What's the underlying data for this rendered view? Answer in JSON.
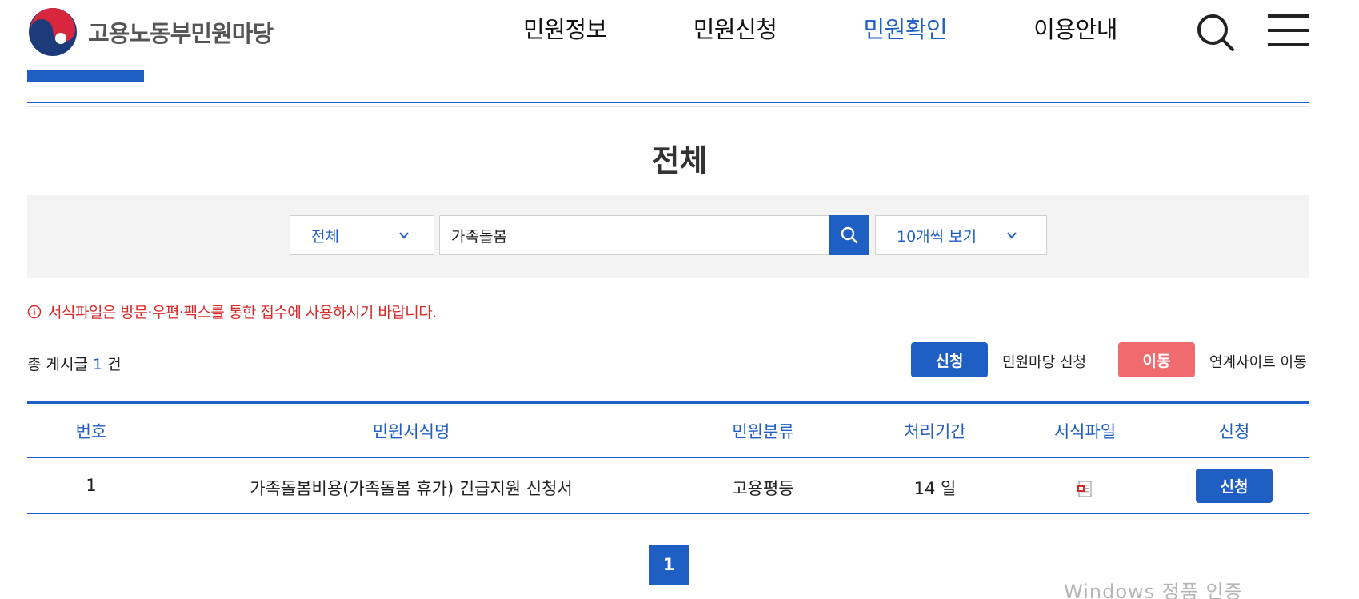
{
  "header": {
    "logo_text": "고용노동부민원마당",
    "nav": [
      "민원정보",
      "민원신청",
      "민원확인",
      "이용안내"
    ],
    "active_nav": "민원확인",
    "search_icon": "search-icon",
    "menu_icon": "hamburger-menu-icon"
  },
  "page": {
    "title": "전체"
  },
  "search": {
    "category": "전체",
    "keyword": "가족돌봄",
    "per_page": "10개씩 보기"
  },
  "notice": "서식파일은 방문·우편·팩스를 통한 접수에 사용하시기 바랍니다.",
  "summary": {
    "prefix": "총 게시글",
    "count": "1",
    "suffix": "건"
  },
  "legend": {
    "apply_button": "신청",
    "apply_text": "민원마당 신청",
    "move_button": "이동",
    "move_text": "연계사이트 이동"
  },
  "table": {
    "headers": [
      "번호",
      "민원서식명",
      "민원분류",
      "처리기간",
      "서식파일",
      "신청"
    ],
    "rows": [
      {
        "no": "1",
        "name": "가족돌봄비용(가족돌봄 휴가) 긴급지원 신청서",
        "category": "고용평등",
        "period": "14 일",
        "file_icon": "pdf-file-icon",
        "action": "신청"
      }
    ]
  },
  "pagination": {
    "current": "1"
  },
  "watermark": "Windows 정품 인증",
  "colors": {
    "accent": "#1f5fc4",
    "move": "#ef6b6e",
    "notice": "#d52b2b"
  }
}
